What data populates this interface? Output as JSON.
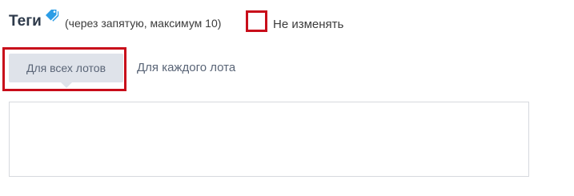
{
  "header": {
    "title": "Теги",
    "hint": "(через запятую, максимум 10)",
    "icon": "tags-icon"
  },
  "no_change": {
    "label": "Не изменять",
    "checked": false
  },
  "tabs": [
    {
      "label": "Для всех лотов",
      "active": true
    },
    {
      "label": "Для каждого лота",
      "active": false
    }
  ],
  "tags_input": {
    "value": "",
    "placeholder": ""
  },
  "colors": {
    "highlight": "#c80d1a",
    "icon": "#2b9de6",
    "active_tab_bg": "#dfe3ea"
  }
}
